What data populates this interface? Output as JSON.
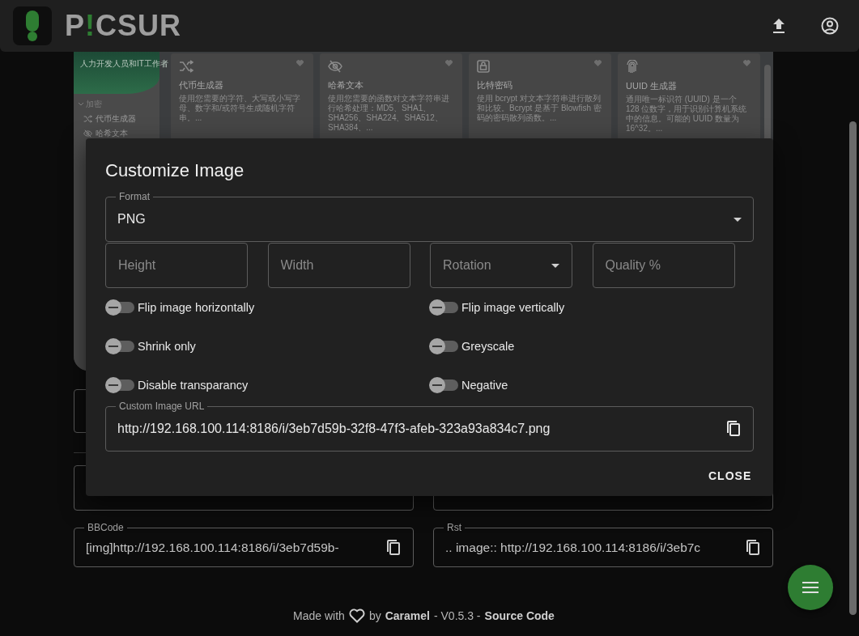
{
  "header": {
    "logo": {
      "lead": "P",
      "mark": "!",
      "rest": "CSUR"
    }
  },
  "preview": {
    "banner": "人力开发人员和IT工作者",
    "section": "加密",
    "nav": [
      {
        "label": "代币生成器"
      },
      {
        "label": "哈希文本"
      }
    ],
    "cards": [
      {
        "title": "代币生成器",
        "desc": "使用您需要的字符、大写或小写字母、数字和/或符号生成随机字符串。..."
      },
      {
        "title": "哈希文本",
        "desc": "使用您需要的函数对文本字符串进行哈希处理：MD5、SHA1、SHA256、SHA224、SHA512、SHA384、..."
      },
      {
        "title": "比特密码",
        "desc": "使用 bcrypt 对文本字符串进行散列和比较。Bcrypt 是基于 Blowfish 密码的密码散列函数。..."
      },
      {
        "title": "UUID 生成器",
        "desc": "通用唯一标识符 (UUID) 是一个 128 位数字，用于识别计算机系统中的信息。可能的 UUID 数量为 16^32。..."
      }
    ]
  },
  "link_fields": [
    {
      "label": "BBCode",
      "value": "[img]http://192.168.100.114:8186/i/3eb7d59b-"
    },
    {
      "label": "Rst",
      "value": ".. image:: http://192.168.100.114:8186/i/3eb7c"
    }
  ],
  "footer": {
    "made": "Made with",
    "by": "by",
    "author": "Caramel",
    "version": "- V0.5.3 -",
    "source": "Source Code"
  },
  "dialog": {
    "title": "Customize Image",
    "format": {
      "label": "Format",
      "value": "PNG"
    },
    "inputs": [
      {
        "kind": "text",
        "placeholder": "Height"
      },
      {
        "kind": "text",
        "placeholder": "Width"
      },
      {
        "kind": "select",
        "placeholder": "Rotation"
      },
      {
        "kind": "text",
        "placeholder": "Quality %"
      }
    ],
    "toggles": [
      {
        "label": "Flip image horizontally",
        "on": false
      },
      {
        "label": "Flip image vertically",
        "on": false
      },
      {
        "label": "Shrink only",
        "on": false
      },
      {
        "label": "Greyscale",
        "on": false
      },
      {
        "label": "Disable transparancy",
        "on": false
      },
      {
        "label": "Negative",
        "on": false
      }
    ],
    "url": {
      "label": "Custom Image URL",
      "value": "http://192.168.100.114:8186/i/3eb7d59b-32f8-47f3-afeb-323a93a834c7.png"
    },
    "close": "CLOSE"
  }
}
